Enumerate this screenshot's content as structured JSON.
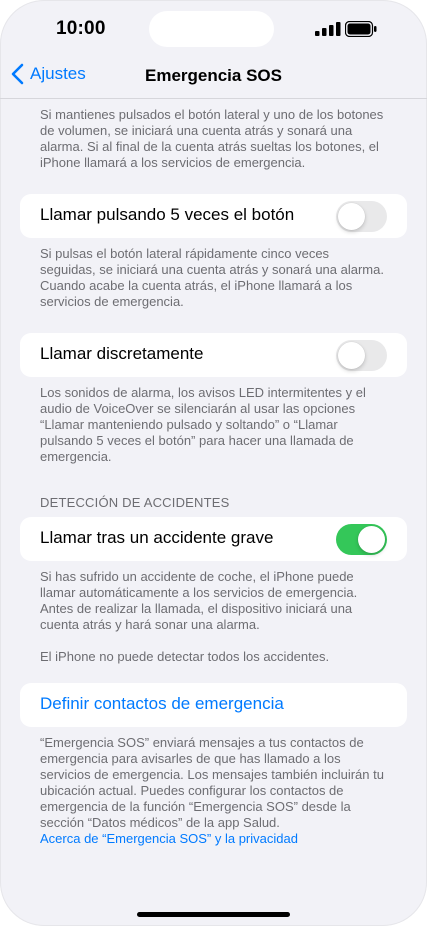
{
  "status_bar": {
    "time": "10:00"
  },
  "nav": {
    "back_label": "Ajustes",
    "title": "Emergencia SOS"
  },
  "intro_footer": "Si mantienes pulsados el botón lateral y uno de los botones de volumen, se iniciará una cuenta atrás y sonará una alarma. Si al final de la cuenta atrás sueltas los botones, el iPhone llamará a los servicios de emergencia.",
  "call_five_presses": {
    "label": "Llamar pulsando 5 veces el botón",
    "enabled": false,
    "footer": "Si pulsas el botón lateral rápidamente cinco veces seguidas, se iniciará una cuenta atrás y sonará una alarma. Cuando acabe la cuenta atrás, el iPhone llamará a los servicios de emergencia."
  },
  "call_quietly": {
    "label": "Llamar discretamente",
    "enabled": false,
    "footer": "Los sonidos de alarma, los avisos LED intermitentes y el audio de VoiceOver se silenciarán al usar las opciones “Llamar manteniendo pulsado y soltando” o “Llamar pulsando 5 veces el botón” para hacer una llamada de emergencia."
  },
  "crash_detection": {
    "header": "DETECCIÓN DE ACCIDENTES",
    "label": "Llamar tras un accidente grave",
    "enabled": true,
    "footer": "Si has sufrido un accidente de coche, el iPhone puede llamar automáticamente a los servicios de emergencia. Antes de realizar la llamada, el dispositivo iniciará una cuenta atrás y hará sonar una alarma.",
    "footer2": "El iPhone no puede detectar todos los accidentes."
  },
  "emergency_contacts": {
    "label": "Definir contactos de emergencia",
    "footer": "“Emergencia SOS” enviará mensajes a tus contactos de emergencia para avisarles de que has llamado a los servicios de emergencia. Los mensajes también incluirán tu ubicación actual. Puedes configurar los contactos de emergencia de la función “Emergencia SOS” desde la sección “Datos médicos” de la app Salud.",
    "privacy_link": "Acerca de “Emergencia SOS” y la privacidad"
  },
  "colors": {
    "accent": "#007aff",
    "toggle_on": "#34c759",
    "background": "#f2f2f7"
  }
}
